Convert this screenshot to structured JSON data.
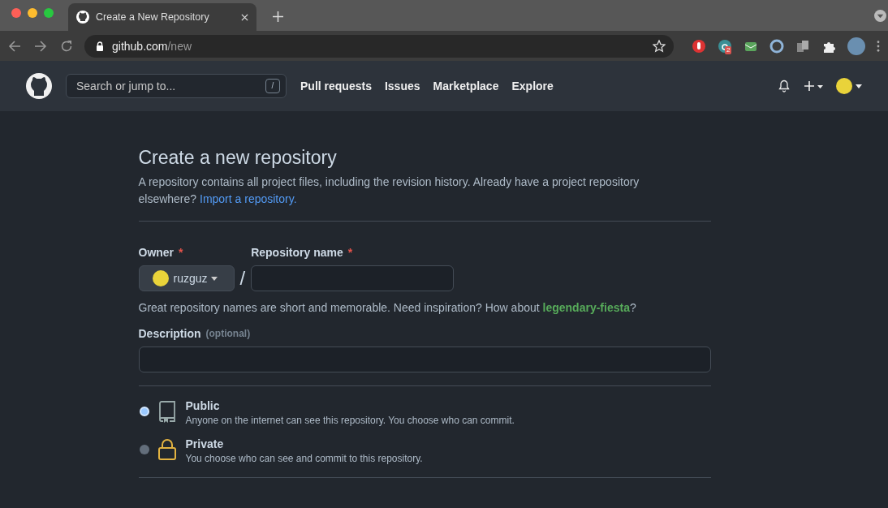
{
  "browser": {
    "tab_title": "Create a New Repository",
    "url_host": "github.com",
    "url_path": "/new",
    "extension_badge": "2"
  },
  "header": {
    "search_placeholder": "Search or jump to...",
    "search_key": "/",
    "nav": [
      "Pull requests",
      "Issues",
      "Marketplace",
      "Explore"
    ]
  },
  "page": {
    "title": "Create a new repository",
    "intro": "A repository contains all project files, including the revision history. Already have a project repository elsewhere?",
    "import_link": "Import a repository.",
    "owner_label": "Owner",
    "required_mark": "*",
    "owner": "ruzguz",
    "separator": "/",
    "name_label": "Repository name",
    "hint": "Great repository names are short and memorable. Need inspiration? How about",
    "suggestion": "legendary-fiesta",
    "hint_end": "?",
    "description_label": "Description",
    "optional": "(optional)",
    "visibility": [
      {
        "kind": "public",
        "title": "Public",
        "text": "Anyone on the internet can see this repository. You choose who can commit.",
        "selected": true
      },
      {
        "kind": "private",
        "title": "Private",
        "text": "You choose who can see and commit to this repository.",
        "selected": false
      }
    ]
  }
}
